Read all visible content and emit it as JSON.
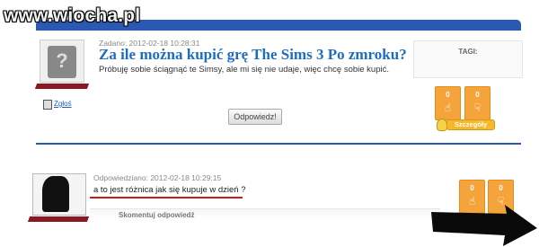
{
  "watermark": {
    "text": "www.wiocha.pl"
  },
  "question": {
    "meta": "Zadano: 2012-02-18 10:28:31",
    "title": "Za ile można kupić grę The Sims 3 Po zmroku?",
    "body": "Próbuję sobie ściągnąć te Simsy, ale mi się nie udaje, więc chcę sobie kupić.",
    "tags_label": "TAGI:",
    "delete_label": "Zgłoś",
    "reply_label": "Odpowiedz!",
    "details_label": "Szczegóły",
    "votes": {
      "up": "0",
      "down": "0"
    }
  },
  "answer": {
    "meta": "Odpowiedziano: 2012-02-18 10:29:15",
    "body": "a to jest różnica jak się kupuje w dzień ?",
    "comment_label": "Skomentuj odpowiedź",
    "votes": {
      "up": "0",
      "down": "0"
    }
  },
  "colors": {
    "header_blue": "#2a59b1",
    "title_blue": "#1f6dbf",
    "vote_orange": "#f5a43c",
    "ribbon_red": "#8a1722"
  },
  "icons": {
    "avatar": "user-silhouette-icon",
    "delete": "trash-icon",
    "vote_up": "thumb-up-icon",
    "vote_down": "thumb-down-icon",
    "details": "lightbulb-icon"
  }
}
